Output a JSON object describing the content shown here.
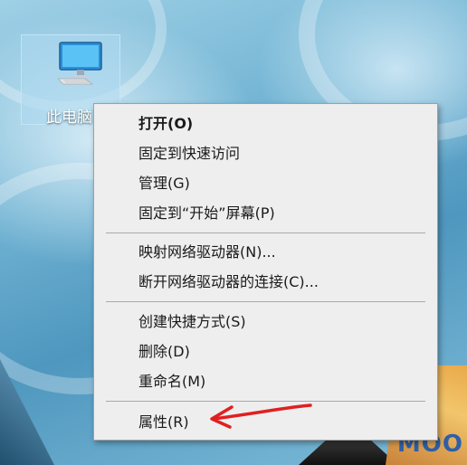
{
  "desktop": {
    "icon": {
      "label": "此电脑",
      "icon_name": "computer-monitor-icon"
    },
    "wallpaper_text": "MOO"
  },
  "context_menu": {
    "groups": [
      {
        "items": [
          {
            "label": "打开(O)",
            "bold": true
          },
          {
            "label": "固定到快速访问",
            "bold": false
          },
          {
            "label": "管理(G)",
            "bold": false
          },
          {
            "label": "固定到“开始”屏幕(P)",
            "bold": false
          }
        ]
      },
      {
        "items": [
          {
            "label": "映射网络驱动器(N)...",
            "bold": false
          },
          {
            "label": "断开网络驱动器的连接(C)...",
            "bold": false
          }
        ]
      },
      {
        "items": [
          {
            "label": "创建快捷方式(S)",
            "bold": false
          },
          {
            "label": "删除(D)",
            "bold": false
          },
          {
            "label": "重命名(M)",
            "bold": false
          }
        ]
      },
      {
        "items": [
          {
            "label": "属性(R)",
            "bold": false
          }
        ]
      }
    ]
  },
  "annotation": {
    "type": "red-arrow-icon",
    "color": "#e02020",
    "points_to": "属性(R)"
  },
  "colors": {
    "menu_background": "#eeeeee",
    "menu_border": "#a0a0a0",
    "separator": "#a9a9a9",
    "icon_selection": "#add8f0"
  }
}
